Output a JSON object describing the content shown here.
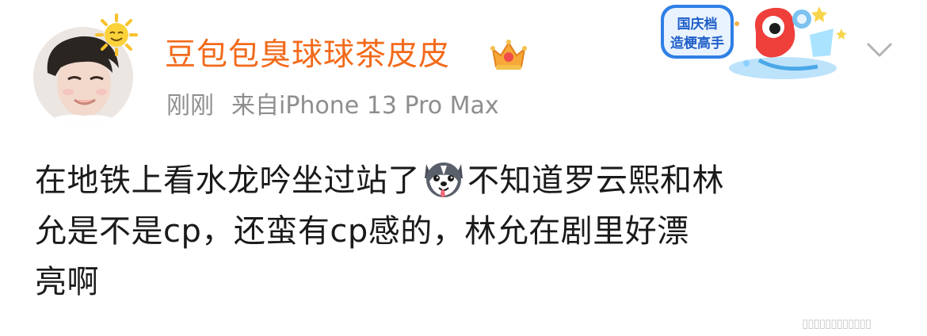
{
  "post": {
    "username": "豆包包臭球球茶皮皮",
    "time": "刚刚",
    "source": "来自iPhone 13 Pro Max",
    "content": {
      "line1_before": "在地铁上看水龙吟坐过站了",
      "line1_after": "不知道罗云熙和林",
      "line2": "允是不是cp，还蛮有cp感的，林允在剧里好漂",
      "line3": "亮啊"
    },
    "decoration_text": [
      "国庆档",
      "造梗高手"
    ]
  },
  "icons": {
    "avatar": "avatar",
    "sun_badge": "sun-icon",
    "vip": "crown-icon",
    "emoji": "husky-emoji-icon",
    "menu": "chevron-down-icon"
  },
  "colors": {
    "username": "#f26a1b",
    "meta": "#8e8e8e",
    "text": "#1a1a1a"
  }
}
